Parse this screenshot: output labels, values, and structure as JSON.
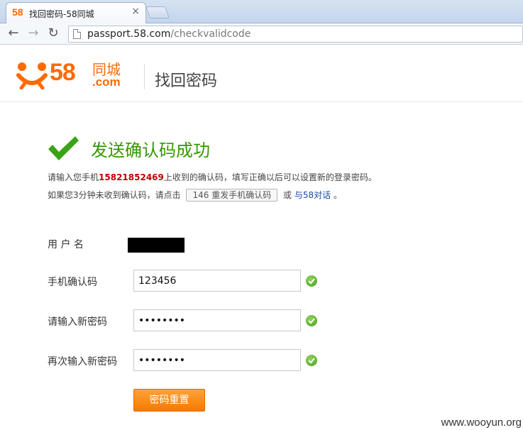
{
  "browser": {
    "tab": {
      "favicon_text": "58",
      "title": "找回密码-58同城",
      "close": "×"
    },
    "nav": {
      "back": "←",
      "forward": "→",
      "reload": "↻"
    },
    "address": {
      "host": "passport.58.com",
      "path": "/checkvalidcode"
    }
  },
  "header": {
    "logo": {
      "number": "58",
      "cn": "同城",
      "com": ".com"
    },
    "title": "找回密码"
  },
  "message": {
    "title": "发送确认码成功",
    "line1_prefix": "请输入您手机",
    "phone": "15821852469",
    "line1_suffix": "上收到的确认码，填写正确以后可以设置新的登录密码。",
    "line2_prefix": "如果您3分钟未收到确认码，请点击",
    "resend_label": "146 重发手机确认码",
    "line2_middle": "或",
    "chat_link": "与58对话",
    "line2_suffix": "。"
  },
  "form": {
    "username_label": "用 户 名",
    "code_label": "手机确认码",
    "code_value": "123456",
    "new_password_label": "请输入新密码",
    "new_password_value": "••••••••",
    "confirm_password_label": "再次输入新密码",
    "confirm_password_value": "••••••••",
    "submit_label": "密码重置"
  },
  "watermark": "www.wooyun.org",
  "colors": {
    "brand": "#ff6a00",
    "success": "#339900",
    "phone": "#c00000",
    "button": "#f67a00"
  }
}
